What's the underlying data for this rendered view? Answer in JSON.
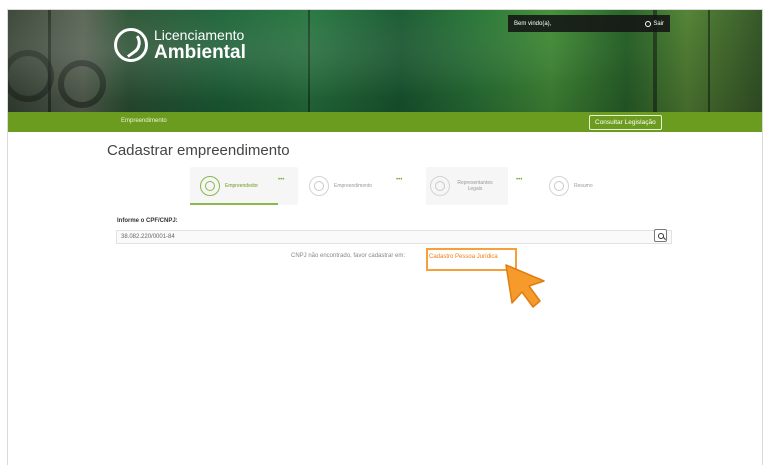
{
  "header": {
    "logo_line1": "Licenciamento",
    "logo_line2": "Ambiental",
    "welcome": "Bem vindo(a),",
    "logout": "Sair"
  },
  "nav": {
    "item": "Empreendimento",
    "button": "Consultar Legislação"
  },
  "page": {
    "title": "Cadastrar empreendimento"
  },
  "stepper": {
    "steps": [
      {
        "label": "Empreendedor",
        "active": true
      },
      {
        "label": "Empreendimento",
        "active": false
      },
      {
        "label": "Representantes Legais",
        "active": false
      },
      {
        "label": "Resumo",
        "active": false
      }
    ],
    "separator": "•••"
  },
  "form": {
    "label": "Informe o CPF/CNPJ:",
    "value": "38.082.220/0001-84"
  },
  "message": {
    "text": "CNPJ não encontrado, favor cadastrar em:",
    "link": "Cadastro Pessoa Jurídica"
  },
  "colors": {
    "accent": "#6c9c1f",
    "highlight": "#f5a03a"
  }
}
